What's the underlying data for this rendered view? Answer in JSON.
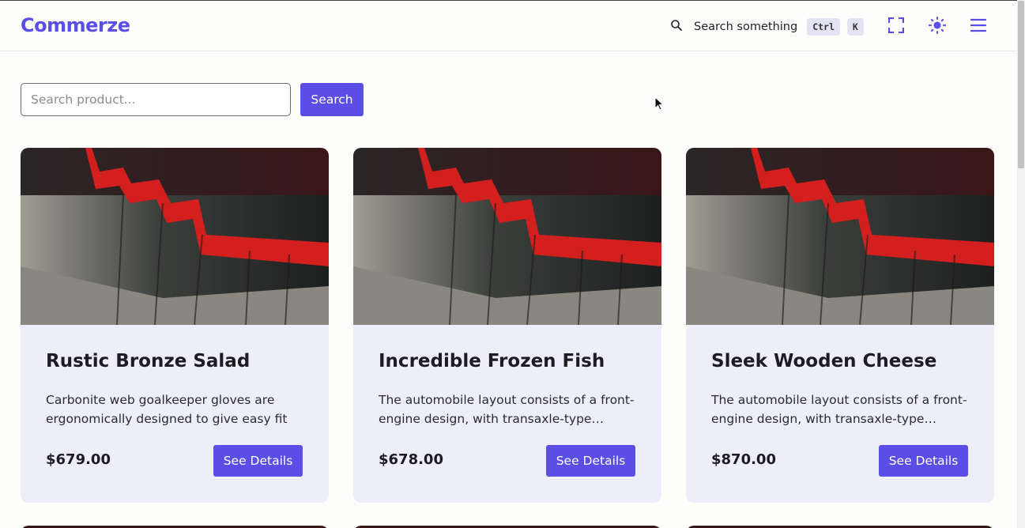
{
  "header": {
    "logo": "Commerze",
    "search_label": "Search something",
    "shortcut_ctrl": "Ctrl",
    "shortcut_key": "K"
  },
  "toolbar": {
    "search_placeholder": "Search product...",
    "search_button": "Search"
  },
  "products": [
    {
      "title": "Rustic Bronze Salad",
      "description": "Carbonite web goalkeeper gloves are ergonomically designed to give easy fit",
      "price": "$679.00",
      "button": "See Details"
    },
    {
      "title": "Incredible Frozen Fish",
      "description": "The automobile layout consists of a front-engine design, with transaxle-type transmissions mounted at the rear of the engine and four wheel drive",
      "price": "$678.00",
      "button": "See Details"
    },
    {
      "title": "Sleek Wooden Cheese",
      "description": "The automobile layout consists of a front-engine design, with transaxle-type transmissions mounted at the rear of the engine and four wheel drive",
      "price": "$870.00",
      "button": "See Details"
    }
  ],
  "icons": {
    "search": "search-icon",
    "fullscreen": "fullscreen-icon",
    "theme": "sun-icon",
    "menu": "hamburger-menu-icon"
  },
  "colors": {
    "brand": "#5b4ee6",
    "card_background": "#eeeefb"
  }
}
